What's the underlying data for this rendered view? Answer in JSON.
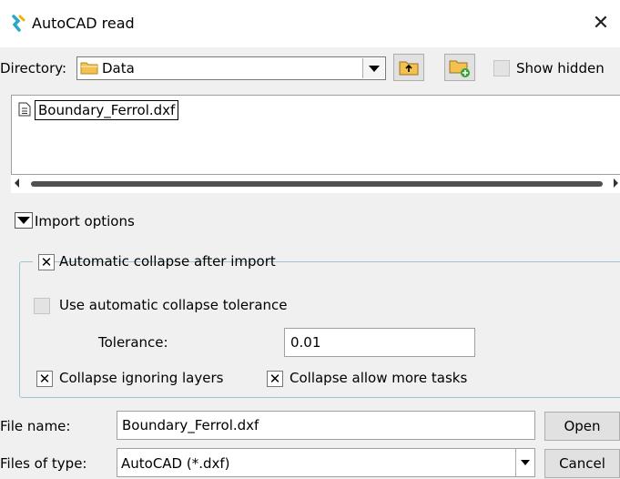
{
  "window": {
    "title": "AutoCAD read"
  },
  "directory": {
    "label": "Directory:",
    "value": "Data",
    "show_hidden_label": "Show hidden",
    "show_hidden_checked": false
  },
  "files": [
    {
      "name": "Boundary_Ferrol.dxf",
      "selected": true
    }
  ],
  "import_options": {
    "label": "Import options",
    "auto_collapse": {
      "label": "Automatic collapse after import",
      "checked": true
    },
    "use_tolerance": {
      "label": "Use automatic collapse tolerance",
      "checked": false,
      "enabled": false
    },
    "tolerance": {
      "label": "Tolerance:",
      "value": "0.01"
    },
    "ignore_layers": {
      "label": "Collapse ignoring layers",
      "checked": true
    },
    "more_tasks": {
      "label": "Collapse allow more tasks",
      "checked": true
    }
  },
  "bottom": {
    "file_name_label": "File name:",
    "file_name_value": "Boundary_Ferrol.dxf",
    "file_type_label": "Files of type:",
    "file_type_value": "AutoCAD (*.dxf)",
    "open_label": "Open",
    "cancel_label": "Cancel"
  },
  "checkmark": "✕",
  "colors": {
    "accent_icon": "#2aa7c9",
    "folder": "#f2c14e",
    "group_border": "#9fc4cf"
  }
}
